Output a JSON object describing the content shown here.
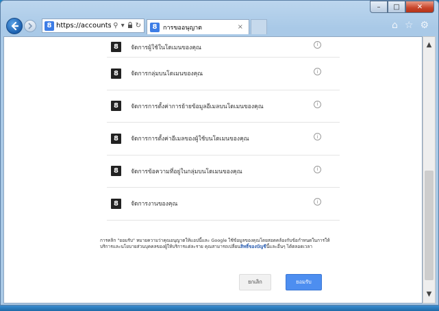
{
  "browser": {
    "url": "https://accounts.g",
    "tab_title": "การขออนุญาต",
    "caption": {
      "minimize": "–",
      "maximize": "□",
      "close": "✕"
    },
    "tab_close": "×",
    "tool_icons": {
      "home": "⌂",
      "favorites": "☆",
      "settings": "⚙"
    },
    "addr_icons": {
      "search": "⚲",
      "dropdown": "▾",
      "lock": "🔒",
      "refresh": "↻"
    }
  },
  "permissions": [
    {
      "icon": "8",
      "label": "จัดการผู้ใช้ในโดเมนของคุณ"
    },
    {
      "icon": "8",
      "label": "จัดการกลุ่มบนโดเมนของคุณ"
    },
    {
      "icon": "8",
      "label": "จัดการการตั้งค่าการย้ายข้อมูลอีเมลบนโดเมนของคุณ"
    },
    {
      "icon": "8",
      "label": "จัดการการตั้งค่าอีเมลของผู้ใช้บนโดเมนของคุณ"
    },
    {
      "icon": "8",
      "label": "จัดการข้อความที่อยู่ในกลุ่มบนโดเมนของคุณ"
    },
    {
      "icon": "8",
      "label": "จัดการงานของคุณ"
    }
  ],
  "info_glyph": "i",
  "consent": {
    "text_before": "การคลิก \"ยอมรับ\" หมายความว่าคุณอนุญาตให้แอปนี้และ Google ใช้ข้อมูลของคุณโดยสอดคล้องกับข้อกำหนดในการให้บริการและนโยบายส่วนบุคคลของผู้ให้บริการแต่ละราย คุณสามารถเปลี่ยน",
    "link": "สิทธิ์ของบัญชี",
    "text_after": "นี้และอื่นๆ ได้ตลอดเวลา"
  },
  "buttons": {
    "cancel": "ยกเลิก",
    "accept": "ยอมรับ"
  },
  "scroll": {
    "up": "▲",
    "down": "▼"
  }
}
